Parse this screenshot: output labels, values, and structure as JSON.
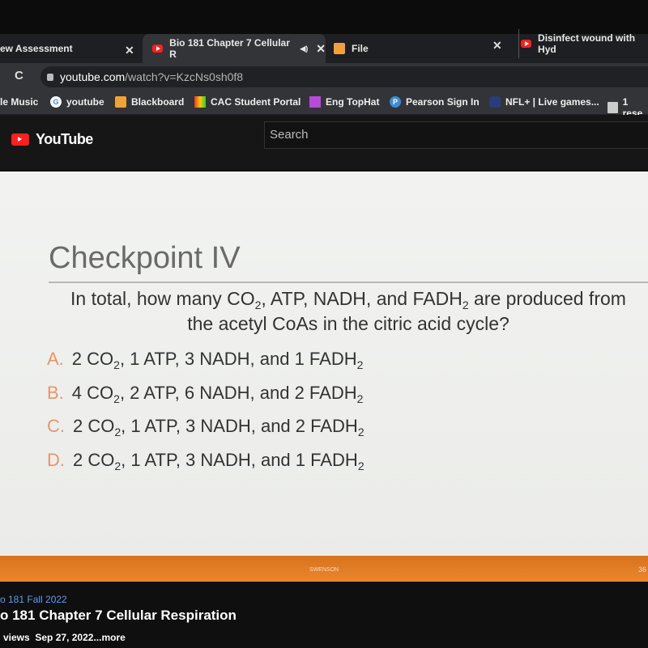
{
  "browser": {
    "tabs": [
      {
        "label": "ew Assessment",
        "close": "✕"
      },
      {
        "label": "Bio 181 Chapter 7 Cellular R",
        "audio": "◀)",
        "close": "✕",
        "active": true
      },
      {
        "label": "File",
        "close": "✕"
      },
      {
        "label": "Disinfect wound with Hyd"
      }
    ],
    "url_host": "youtube.com",
    "url_path": "/watch?v=KzcNs0sh0f8",
    "reload": "C",
    "bookmarks": [
      "le Music",
      "youtube",
      "Blackboard",
      "CAC Student Portal",
      "Eng TopHat",
      "Pearson Sign In",
      "NFL+ | Live games...",
      "1 rese"
    ]
  },
  "youtube": {
    "logo": "YouTube",
    "search_placeholder": "Search"
  },
  "slide": {
    "title": "Checkpoint IV",
    "question": {
      "p1": "In total, how many CO",
      "s1": "2",
      "p2": ", ATP, NADH, and FADH",
      "s2": "2",
      "p3": " are produced from",
      "line2": "the acetyl CoAs in the citric acid cycle?"
    },
    "options": [
      {
        "letter": "A.",
        "a": "2 CO",
        "sa": "2",
        "b": ", 1 ATP, 3 NADH, and 1 FADH",
        "sb": "2"
      },
      {
        "letter": "B.",
        "a": "4 CO",
        "sa": "2",
        "b": ", 2 ATP, 6 NADH, and 2 FADH",
        "sb": "2"
      },
      {
        "letter": "C.",
        "a": "2 CO",
        "sa": "2",
        "b": ", 1 ATP, 3 NADH, and 2 FADH",
        "sb": "2"
      },
      {
        "letter": "D.",
        "a": "2 CO",
        "sa": "2",
        "b": ", 1 ATP, 3 NADH, and 1 FADH",
        "sb": "2"
      }
    ],
    "footer": "SWENSON",
    "page": "36"
  },
  "video": {
    "playlist": "o 181 Fall 2022",
    "title": "o 181 Chapter 7 Cellular Respiration",
    "views": "views",
    "date": "Sep 27, 2022",
    "more": "...more"
  },
  "colors": {
    "accent": "#e07a22",
    "option_letter": "#e8956a",
    "youtube_red": "#ff1f1f"
  }
}
